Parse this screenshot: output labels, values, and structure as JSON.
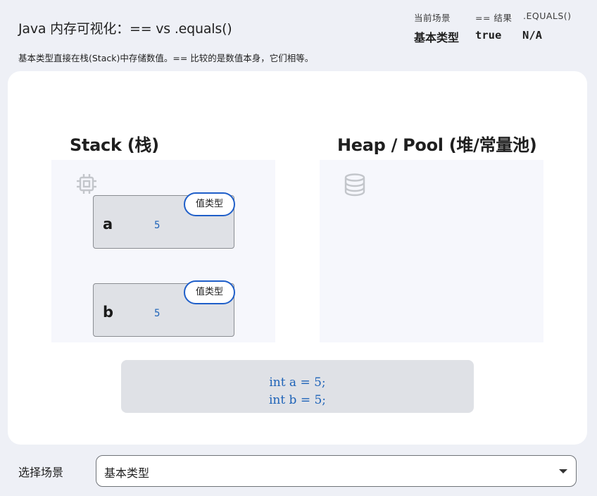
{
  "header": {
    "title": "Java 内存可视化：== vs .equals()",
    "description": "基本类型直接在栈(Stack)中存储数值。== 比较的是数值本身，它们相等。"
  },
  "status": {
    "scenario_header": "当前场景",
    "eq_header": "== 结果",
    "equals_header": ".EQUALS()",
    "scenario_value": "基本类型",
    "eq_value": "true",
    "equals_value": "N/A"
  },
  "stack": {
    "title": "Stack (栈)",
    "icon": "chip-icon",
    "variables": [
      {
        "name": "a",
        "value": "5",
        "badge": "值类型"
      },
      {
        "name": "b",
        "value": "5",
        "badge": "值类型"
      }
    ]
  },
  "heap": {
    "title": "Heap / Pool (堆/常量池)",
    "icon": "database-icon"
  },
  "code": {
    "lines": [
      "int a = 5;",
      "int b = 5;"
    ]
  },
  "selector": {
    "label": "选择场景",
    "value": "基本类型"
  },
  "colors": {
    "accent": "#1f5fc9",
    "value_text": "#1e63b8",
    "background": "#eef0f6"
  }
}
